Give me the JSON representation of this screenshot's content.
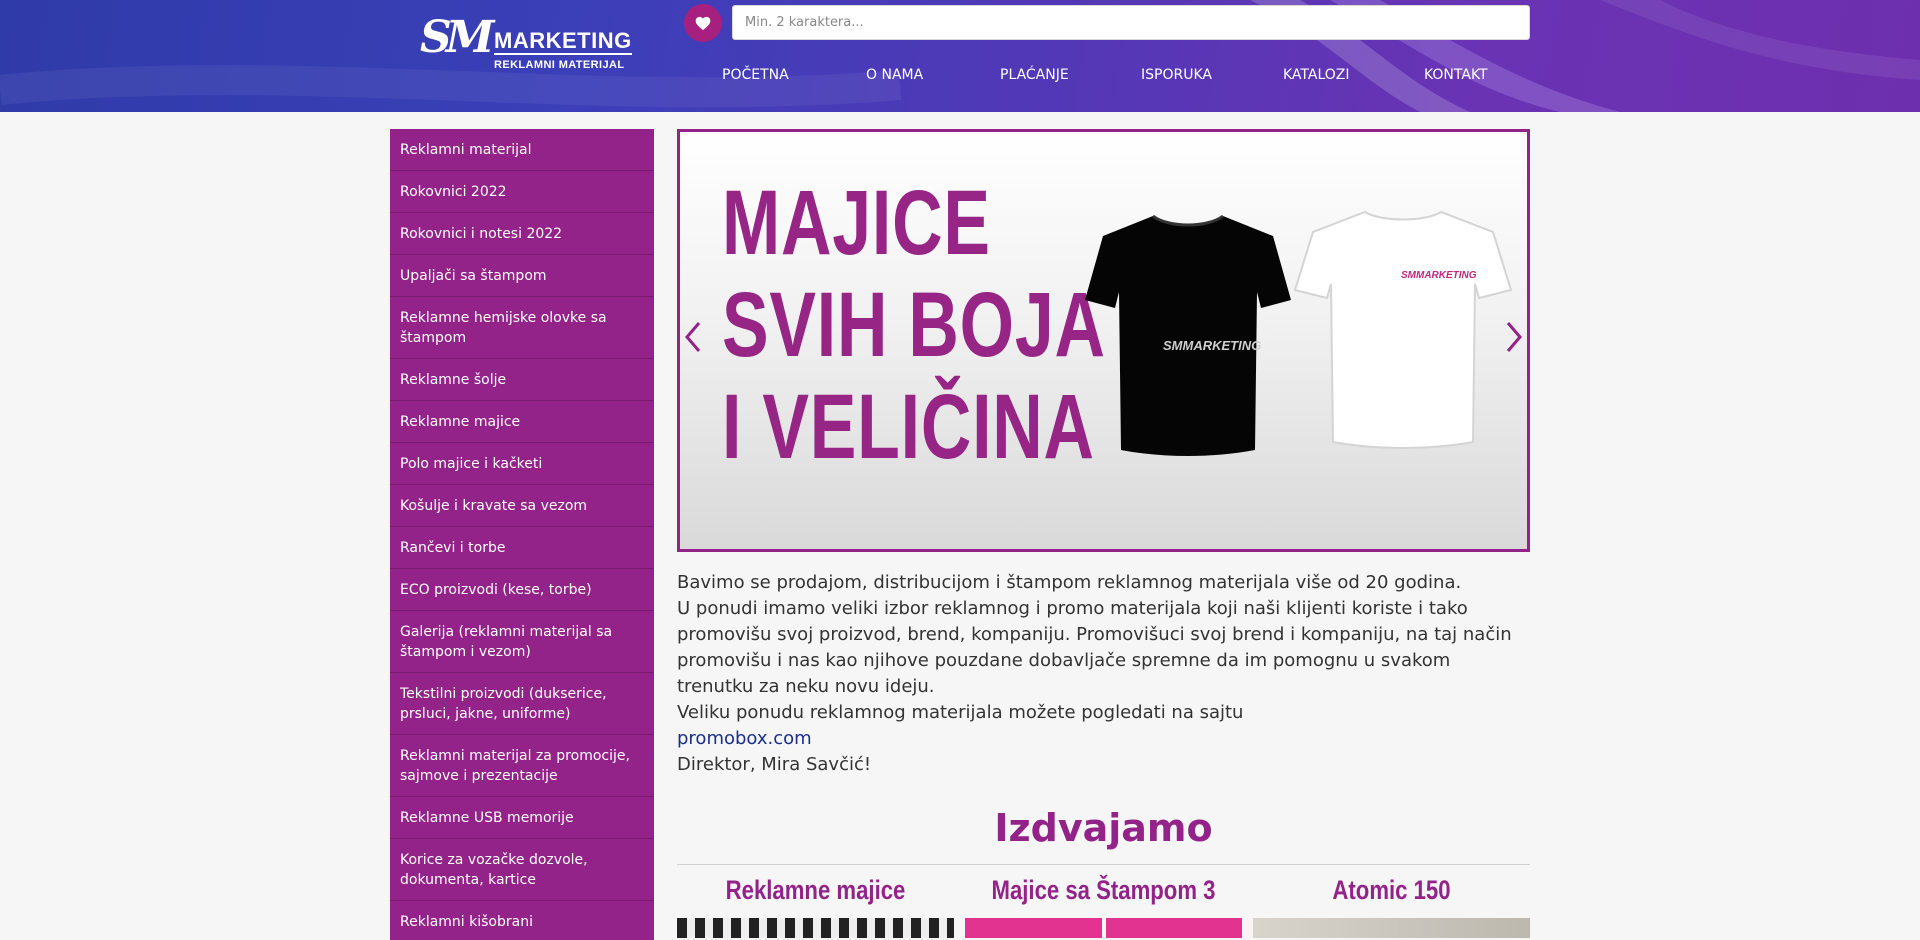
{
  "header": {
    "logo_monogram": "SM",
    "logo_brand": "MARKETING",
    "logo_tagline": "REKLAMNI MATERIJAL",
    "search_placeholder": "Min. 2 karaktera...",
    "wishlist_icon": "heart-icon"
  },
  "nav": [
    {
      "label": "POČETNA"
    },
    {
      "label": "O NAMA"
    },
    {
      "label": "PLAĆANJE"
    },
    {
      "label": "ISPORUKA"
    },
    {
      "label": "KATALOZI"
    },
    {
      "label": "KONTAKT"
    }
  ],
  "sidebar": {
    "items": [
      {
        "label": "Reklamni materijal"
      },
      {
        "label": "Rokovnici 2022"
      },
      {
        "label": "Rokovnici i notesi 2022"
      },
      {
        "label": "Upaljači sa štampom"
      },
      {
        "label": "Reklamne hemijske olovke sa štampom"
      },
      {
        "label": "Reklamne šolje"
      },
      {
        "label": "Reklamne majice"
      },
      {
        "label": "Polo majice i kačketi"
      },
      {
        "label": "Košulje i kravate sa vezom"
      },
      {
        "label": "Rančevi i torbe"
      },
      {
        "label": "ECO proizvodi (kese, torbe)"
      },
      {
        "label": "Galerija (reklamni materijal sa štampom i vezom)"
      },
      {
        "label": "Tekstilni proizvodi (dukserice, prsluci, jakne, uniforme)"
      },
      {
        "label": "Reklamni materijal za promocije, sajmove i prezentacije"
      },
      {
        "label": "Reklamne USB memorije"
      },
      {
        "label": "Korice za vozačke dozvole, dokumenta, kartice"
      },
      {
        "label": "Reklamni kišobrani"
      }
    ]
  },
  "slider": {
    "headline": [
      "MAJICE",
      "SVIH BOJA",
      "I VELIČINA"
    ],
    "shirt_print": "SMMARKETING",
    "prev_icon": "chevron-left-icon",
    "next_icon": "chevron-right-icon"
  },
  "intro": {
    "paragraph1": "Bavimo se prodajom, distribucijom i štampom reklamnog materijala više od 20 godina.",
    "paragraph2": "U ponudi imamo veliki izbor reklamnog i promo materijala koji naši klijenti koriste i tako promovišu svoj proizvod, brend, kompaniju. Promovišuci svoj brend i kompaniju, na taj način promovišu i nas kao njihove pouzdane dobavljače spremne da im pomognu u svakom trenutku za neku novu ideju.",
    "paragraph3": "Veliku ponudu reklamnog materijala možete pogledati na sajtu",
    "link": "promobox.com",
    "signature": "Direktor, Mira Savčić!"
  },
  "featured": {
    "title": "Izdvajamo",
    "products": [
      {
        "name": "Reklamne majice"
      },
      {
        "name": "Majice sa Štampom 3"
      },
      {
        "name": "Atomic 150"
      }
    ]
  },
  "colors": {
    "brand_purple": "#932388",
    "header_blue": "#2f3ba8",
    "link_blue": "#1a2f8a"
  }
}
